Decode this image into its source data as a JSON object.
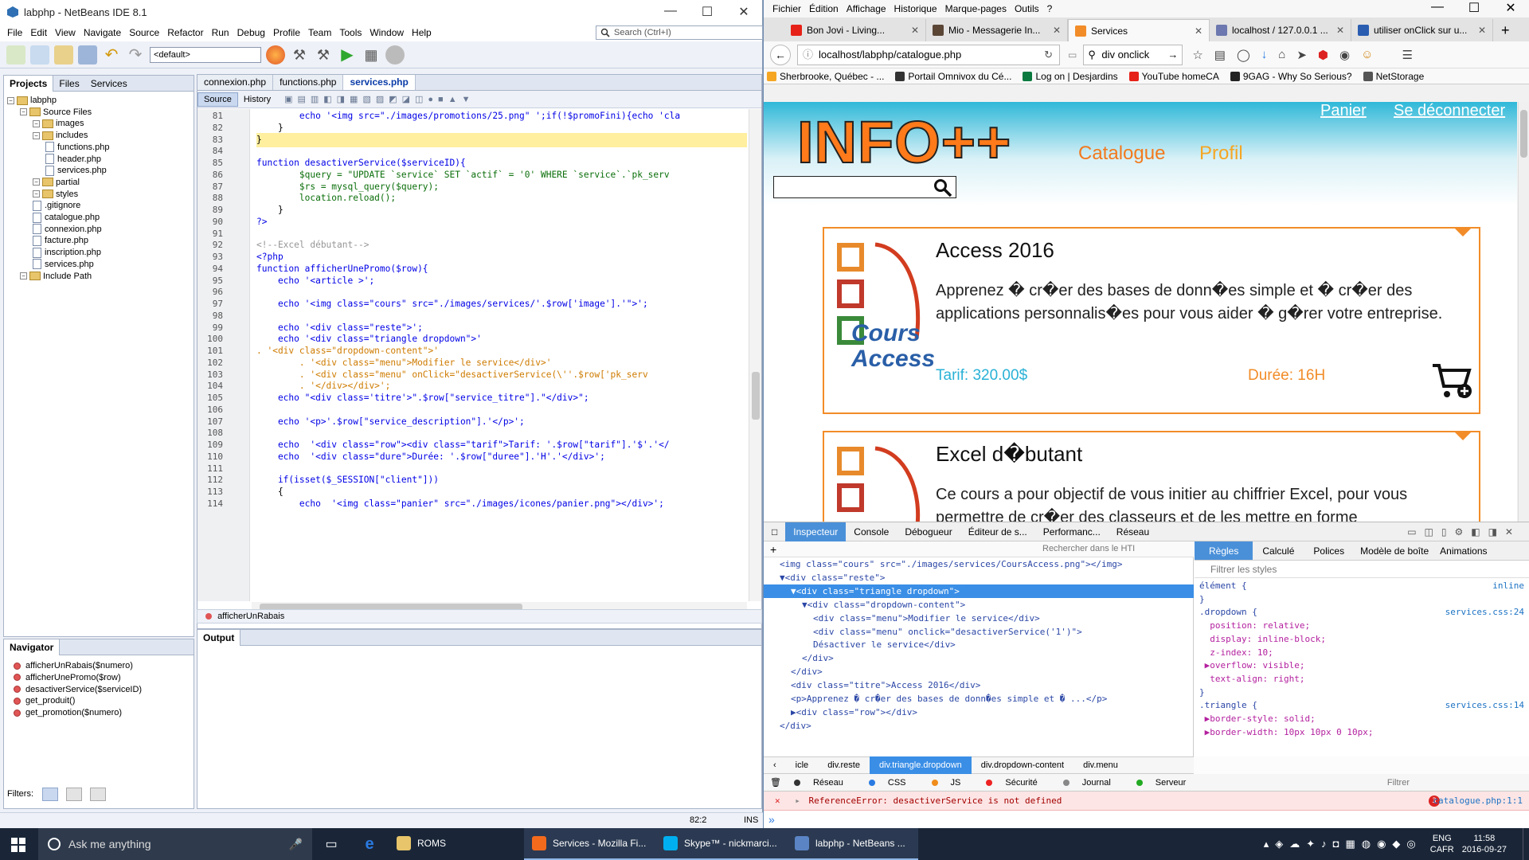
{
  "netbeans": {
    "title": "labphp - NetBeans IDE 8.1",
    "menu": [
      "File",
      "Edit",
      "View",
      "Navigate",
      "Source",
      "Refactor",
      "Run",
      "Debug",
      "Profile",
      "Team",
      "Tools",
      "Window",
      "Help"
    ],
    "search_placeholder": "Search (Ctrl+I)",
    "config": "<default>",
    "project_tabs": [
      "Projects",
      "Files",
      "Services"
    ],
    "tree": [
      {
        "label": "labphp",
        "type": "project",
        "indent": 0
      },
      {
        "label": "Source Files",
        "type": "folder",
        "indent": 1
      },
      {
        "label": "images",
        "type": "folder",
        "indent": 2
      },
      {
        "label": "includes",
        "type": "folder",
        "indent": 2
      },
      {
        "label": "functions.php",
        "type": "file",
        "indent": 3
      },
      {
        "label": "header.php",
        "type": "file",
        "indent": 3
      },
      {
        "label": "services.php",
        "type": "file",
        "indent": 3
      },
      {
        "label": "partial",
        "type": "folder",
        "indent": 2
      },
      {
        "label": "styles",
        "type": "folder",
        "indent": 2
      },
      {
        "label": ".gitignore",
        "type": "file",
        "indent": 2
      },
      {
        "label": "catalogue.php",
        "type": "file",
        "indent": 2
      },
      {
        "label": "connexion.php",
        "type": "file",
        "indent": 2
      },
      {
        "label": "facture.php",
        "type": "file",
        "indent": 2
      },
      {
        "label": "inscription.php",
        "type": "file",
        "indent": 2
      },
      {
        "label": "services.php",
        "type": "file",
        "indent": 2
      },
      {
        "label": "Include Path",
        "type": "folder",
        "indent": 1
      }
    ],
    "navigator_title": "Navigator",
    "navigator_items": [
      "afficherUnRabais($numero)",
      "afficherUnePromo($row)",
      "desactiverService($serviceID)",
      "get_produit()",
      "get_promotion($numero)"
    ],
    "filters_label": "Filters:",
    "editor_tabs": [
      "connexion.php",
      "functions.php",
      "services.php"
    ],
    "source_label": "Source",
    "history_label": "History",
    "code_lines": [
      {
        "n": "81",
        "t": "        echo '<img src=\"./images/promotions/25.png\" ';if(!$promoFini){echo 'cla"
      },
      {
        "n": "82",
        "t": "    }"
      },
      {
        "n": "83",
        "t": "}"
      },
      {
        "n": "84",
        "t": ""
      },
      {
        "n": "85",
        "t": "function desactiverService($serviceID){"
      },
      {
        "n": "86",
        "t": "        $query = \"UPDATE `service` SET `actif` = '0' WHERE `service`.`pk_serv"
      },
      {
        "n": "87",
        "t": "        $rs = mysql_query($query);"
      },
      {
        "n": "88",
        "t": "        location.reload();"
      },
      {
        "n": "89",
        "t": "    }"
      },
      {
        "n": "90",
        "t": "?>"
      },
      {
        "n": "91",
        "t": ""
      },
      {
        "n": "92",
        "t": "<!--Excel débutant-->"
      },
      {
        "n": "93",
        "t": "<?php"
      },
      {
        "n": "94",
        "t": "function afficherUnePromo($row){"
      },
      {
        "n": "95",
        "t": "    echo '<article >';"
      },
      {
        "n": "96",
        "t": ""
      },
      {
        "n": "97",
        "t": "    echo '<img class=\"cours\" src=\"./images/services/'.$row['image'].'\">';"
      },
      {
        "n": "98",
        "t": ""
      },
      {
        "n": "99",
        "t": "    echo '<div class=\"reste\">';"
      },
      {
        "n": "100",
        "t": "    echo '<div class=\"triangle dropdown\">'"
      },
      {
        "n": "101",
        "t": ". '<div class=\"dropdown-content\">'"
      },
      {
        "n": "102",
        "t": "        . '<div class=\"menu\">Modifier le service</div>'"
      },
      {
        "n": "103",
        "t": "        . '<div class=\"menu\" onClick=\"desactiverService(\\''.$row['pk_serv"
      },
      {
        "n": "104",
        "t": "        . '</div></div>';"
      },
      {
        "n": "105",
        "t": "    echo \"<div class='titre'>\".$row[\"service_titre\"].\"</div>\";"
      },
      {
        "n": "106",
        "t": ""
      },
      {
        "n": "107",
        "t": "    echo '<p>'.$row[\"service_description\"].'</p>';"
      },
      {
        "n": "108",
        "t": ""
      },
      {
        "n": "109",
        "t": "    echo  '<div class=\"row\"><div class=\"tarif\">Tarif: '.$row[\"tarif\"].'$'.'</"
      },
      {
        "n": "110",
        "t": "    echo  '<div class=\"dure\">Durée: '.$row[\"duree\"].'H'.'</div>';"
      },
      {
        "n": "111",
        "t": ""
      },
      {
        "n": "112",
        "t": "    if(isset($_SESSION[\"client\"]))"
      },
      {
        "n": "113",
        "t": "    {"
      },
      {
        "n": "114",
        "t": "        echo  '<img class=\"panier\" src=\"./images/icones/panier.png\"></div>';"
      }
    ],
    "breadcrumb": "afficherUnRabais",
    "output_title": "Output",
    "status_position": "82:2",
    "status_mode": "INS"
  },
  "firefox": {
    "menu": [
      "Fichier",
      "Édition",
      "Affichage",
      "Historique",
      "Marque-pages",
      "Outils",
      "?"
    ],
    "tabs": [
      {
        "label": "Bon Jovi - Living...",
        "color": "#e62117"
      },
      {
        "label": "Mio - Messagerie In...",
        "color": "#5b4636"
      },
      {
        "label": "Services",
        "color": "#f28c28",
        "active": true
      },
      {
        "label": "localhost / 127.0.0.1 ...",
        "color": "#6c78af"
      },
      {
        "label": "utiliser onClick sur u...",
        "color": "#2a5db0"
      }
    ],
    "url": "localhost/labphp/catalogue.php",
    "search_value": "div onclick",
    "bookmarks": [
      {
        "label": "Sherbrooke, Québec - ...",
        "color": "#f5a623"
      },
      {
        "label": "Portail Omnivox du Cé...",
        "color": "#333"
      },
      {
        "label": "Log on | Desjardins",
        "color": "#0a7a3f"
      },
      {
        "label": "YouTube homeCA",
        "color": "#e62117"
      },
      {
        "label": "9GAG - Why So Serious?",
        "color": "#222"
      },
      {
        "label": "NetStorage",
        "color": "#555"
      }
    ]
  },
  "site": {
    "brand": "INFO++",
    "panier": "Panier",
    "deconnecter": "Se déconnecter",
    "nav_catalogue": "Catalogue",
    "nav_profil": "Profil",
    "cards": [
      {
        "title": "Access 2016",
        "description": "Apprenez � cr�er des bases de donn�es simple et � cr�er des applications personnalis�es pour vous aider � g�rer votre entreprise.",
        "tarif": "Tarif: 320.00$",
        "duree": "Durée: 16H",
        "logo_text": "Cours Access"
      },
      {
        "title": "Excel d�butant",
        "description": "Ce cours a pour objectif de vous initier au chiffrier Excel, pour vous permettre de cr�er des classeurs et de les mettre en forme"
      }
    ]
  },
  "devtools": {
    "tabs": [
      "Inspecteur",
      "Console",
      "Débogueur",
      "Éditeur de s...",
      "Performanc...",
      "Réseau"
    ],
    "search_placeholder": "Rechercher dans le HTI",
    "markup": [
      {
        "t": "<img class=\"cours\" src=\"./images/services/CoursAccess.png\"></img>",
        "indent": 1
      },
      {
        "t": "▼<div class=\"reste\">",
        "indent": 1
      },
      {
        "t": "▼<div class=\"triangle dropdown\">",
        "indent": 2,
        "selected": true
      },
      {
        "t": "▼<div class=\"dropdown-content\">",
        "indent": 3
      },
      {
        "t": "<div class=\"menu\">Modifier le service</div>",
        "indent": 4
      },
      {
        "t": "<div class=\"menu\" onclick=\"desactiverService('1')\">",
        "indent": 4
      },
      {
        "t": "Désactiver le service</div>",
        "indent": 4
      },
      {
        "t": "</div>",
        "indent": 3
      },
      {
        "t": "</div>",
        "indent": 2
      },
      {
        "t": "<div class=\"titre\">Access 2016</div>",
        "indent": 2
      },
      {
        "t": "<p>Apprenez � cr�er des bases de donn�es simple et � ...</p>",
        "indent": 2
      },
      {
        "t": "▶<div class=\"row\"></div>",
        "indent": 2
      },
      {
        "t": "</div>",
        "indent": 1
      }
    ],
    "rule_tabs": [
      "Règles",
      "Calculé",
      "Polices",
      "Modèle de boîte",
      "Animations"
    ],
    "filter_placeholder": "Filtrer les styles",
    "rules": [
      {
        "t": "élément {",
        "src": "inline"
      },
      {
        "t": "}",
        "src": ""
      },
      {
        "t": ".dropdown {",
        "src": "services.css:24"
      },
      {
        "t": "  position: relative;",
        "src": ""
      },
      {
        "t": "  display: inline-block;",
        "src": ""
      },
      {
        "t": "  z-index: 10;",
        "src": ""
      },
      {
        "t": " ▶overflow: visible;",
        "src": ""
      },
      {
        "t": "  text-align: right;",
        "src": ""
      },
      {
        "t": "}",
        "src": ""
      },
      {
        "t": ".triangle {",
        "src": "services.css:14"
      },
      {
        "t": " ▶border-style: solid;",
        "src": ""
      },
      {
        "t": " ▶border-width: 10px 10px 0 10px;",
        "src": ""
      }
    ],
    "crumbs": [
      "icle",
      "div.reste",
      "div.triangle.dropdown",
      "div.dropdown-content",
      "div.menu"
    ],
    "console_filters": [
      "Réseau",
      "CSS",
      "JS",
      "Sécurité",
      "Journal",
      "Serveur"
    ],
    "console_filter_placeholder": "Filtrer",
    "error_message": "ReferenceError: desactiverService is not defined",
    "error_count": "3",
    "error_source": "catalogue.php:1:1"
  },
  "taskbar": {
    "search": "Ask me anything",
    "tasks": [
      {
        "label": "ROMS",
        "color": "#e8c56a"
      },
      {
        "label": "Services - Mozilla Fi...",
        "color": "#f36a1d",
        "open": true
      },
      {
        "label": "Skype™ - nickmarci...",
        "color": "#00aff0",
        "open": true
      },
      {
        "label": "labphp - NetBeans ...",
        "color": "#5a84c4",
        "open": true
      }
    ],
    "lang1": "ENG",
    "lang2": "CAFR",
    "time": "11:58",
    "date": "2016-09-27"
  }
}
